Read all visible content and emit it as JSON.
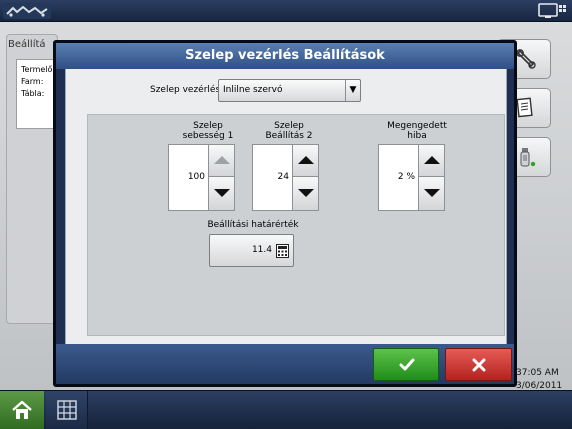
{
  "background": {
    "panel_title": "Beállítá",
    "info_lines": [
      "Termelő",
      "Farm:",
      "Tábla:"
    ],
    "clock_time": "37:05 AM",
    "clock_date": "3/06/2011"
  },
  "modal": {
    "title": "Szelep vezérlés Beállítások",
    "valve_control_label": "Szelep vezérlés",
    "valve_control_value": "Inlilne szervó",
    "fields": [
      {
        "label_line1": "Szelep",
        "label_line2": "sebesség 1",
        "value": "100"
      },
      {
        "label_line1": "Szelep",
        "label_line2": "Beállítás 2",
        "value": "24"
      },
      {
        "label_line1": "Megengedett",
        "label_line2": "hiba",
        "value": "2 %"
      }
    ],
    "threshold_label": "Beállítási határérték",
    "threshold_value": "11.4"
  },
  "colors": {
    "ok": "#2fa427",
    "cancel": "#cc3530",
    "title_bar": "#3f6399"
  },
  "icons": {
    "ok": "checkmark-icon",
    "cancel": "x-icon",
    "home": "home-icon",
    "grid": "grid-icon",
    "calculator": "calculator-icon",
    "wrench": "wrench-icon",
    "document": "document-icon",
    "sprayer": "sprayer-icon"
  }
}
